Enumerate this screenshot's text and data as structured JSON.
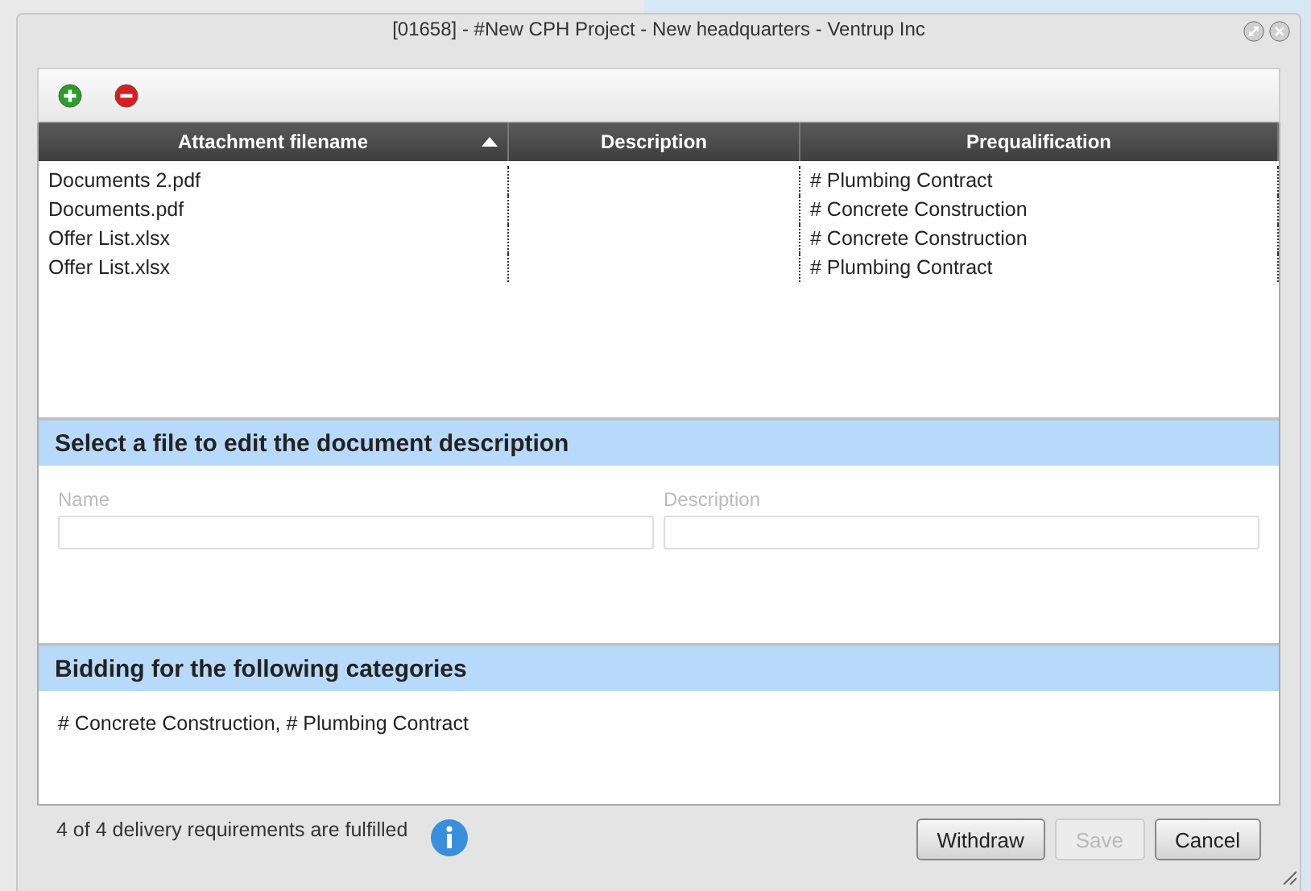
{
  "window": {
    "title": "[01658] - #New CPH Project - New headquarters - Ventrup Inc"
  },
  "table": {
    "columns": [
      {
        "label": "Attachment filename",
        "sorted": true
      },
      {
        "label": "Description",
        "sorted": false
      },
      {
        "label": "Prequalification",
        "sorted": false
      }
    ],
    "rows": [
      {
        "filename": "Documents 2.pdf",
        "prequalification": "# Plumbing Contract"
      },
      {
        "filename": "Documents.pdf",
        "prequalification": "# Concrete Construction"
      },
      {
        "filename": "Offer List.xlsx",
        "prequalification": "# Concrete Construction"
      },
      {
        "filename": "Offer List.xlsx",
        "prequalification": "# Plumbing Contract"
      }
    ]
  },
  "edit_section": {
    "title": "Select a file to edit the document description",
    "fields": [
      {
        "label": "Name",
        "disabled": true
      },
      {
        "label": "Description",
        "disabled": true
      }
    ]
  },
  "categories_section": {
    "title": "Bidding for the following categories",
    "text": "# Concrete Construction, # Plumbing Contract"
  },
  "status": "4 of 4 delivery requirements are fulfilled",
  "buttons": [
    {
      "label": "Withdraw",
      "disabled": false
    },
    {
      "label": "Save",
      "disabled": true
    },
    {
      "label": "Cancel",
      "disabled": false
    }
  ]
}
